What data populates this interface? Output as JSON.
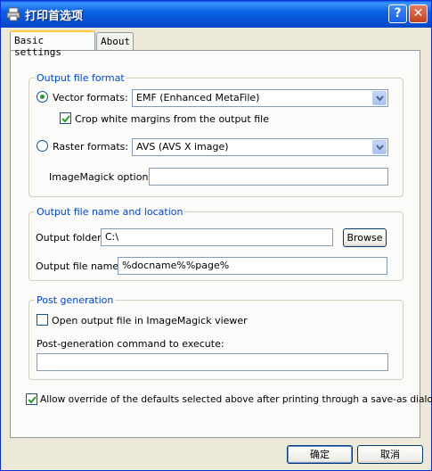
{
  "window": {
    "title": "打印首选项",
    "help_glyph": "?",
    "close_glyph": "✕"
  },
  "tabs": [
    {
      "label": "Basic settings",
      "active": true
    },
    {
      "label": "About",
      "active": false
    }
  ],
  "output_format": {
    "title": "Output file format",
    "vector_label": "Vector formats:",
    "vector_value": "EMF (Enhanced MetaFile)",
    "crop_label": "Crop white margins from the output file",
    "raster_label": "Raster formats:",
    "raster_value": "AVS (AVS X image)",
    "imagemagick_label": "ImageMagick options:",
    "imagemagick_value": ""
  },
  "output_location": {
    "title": "Output file name and location",
    "folder_label": "Output folder:",
    "folder_value": "C:\\",
    "browse_label": "Browse",
    "name_label": "Output file name:",
    "name_value": "%docname%%page%"
  },
  "post_generation": {
    "title": "Post generation",
    "open_viewer_label": "Open output file in ImageMagick viewer",
    "command_label": "Post-generation command to execute:",
    "command_value": ""
  },
  "override_label": "Allow override of the defaults selected above after printing through a save-as dialog",
  "footer": {
    "ok_label": "确定",
    "cancel_label": "取消"
  },
  "colors": {
    "group_title": "#0046d5",
    "titlebar": "#0a61e5"
  }
}
